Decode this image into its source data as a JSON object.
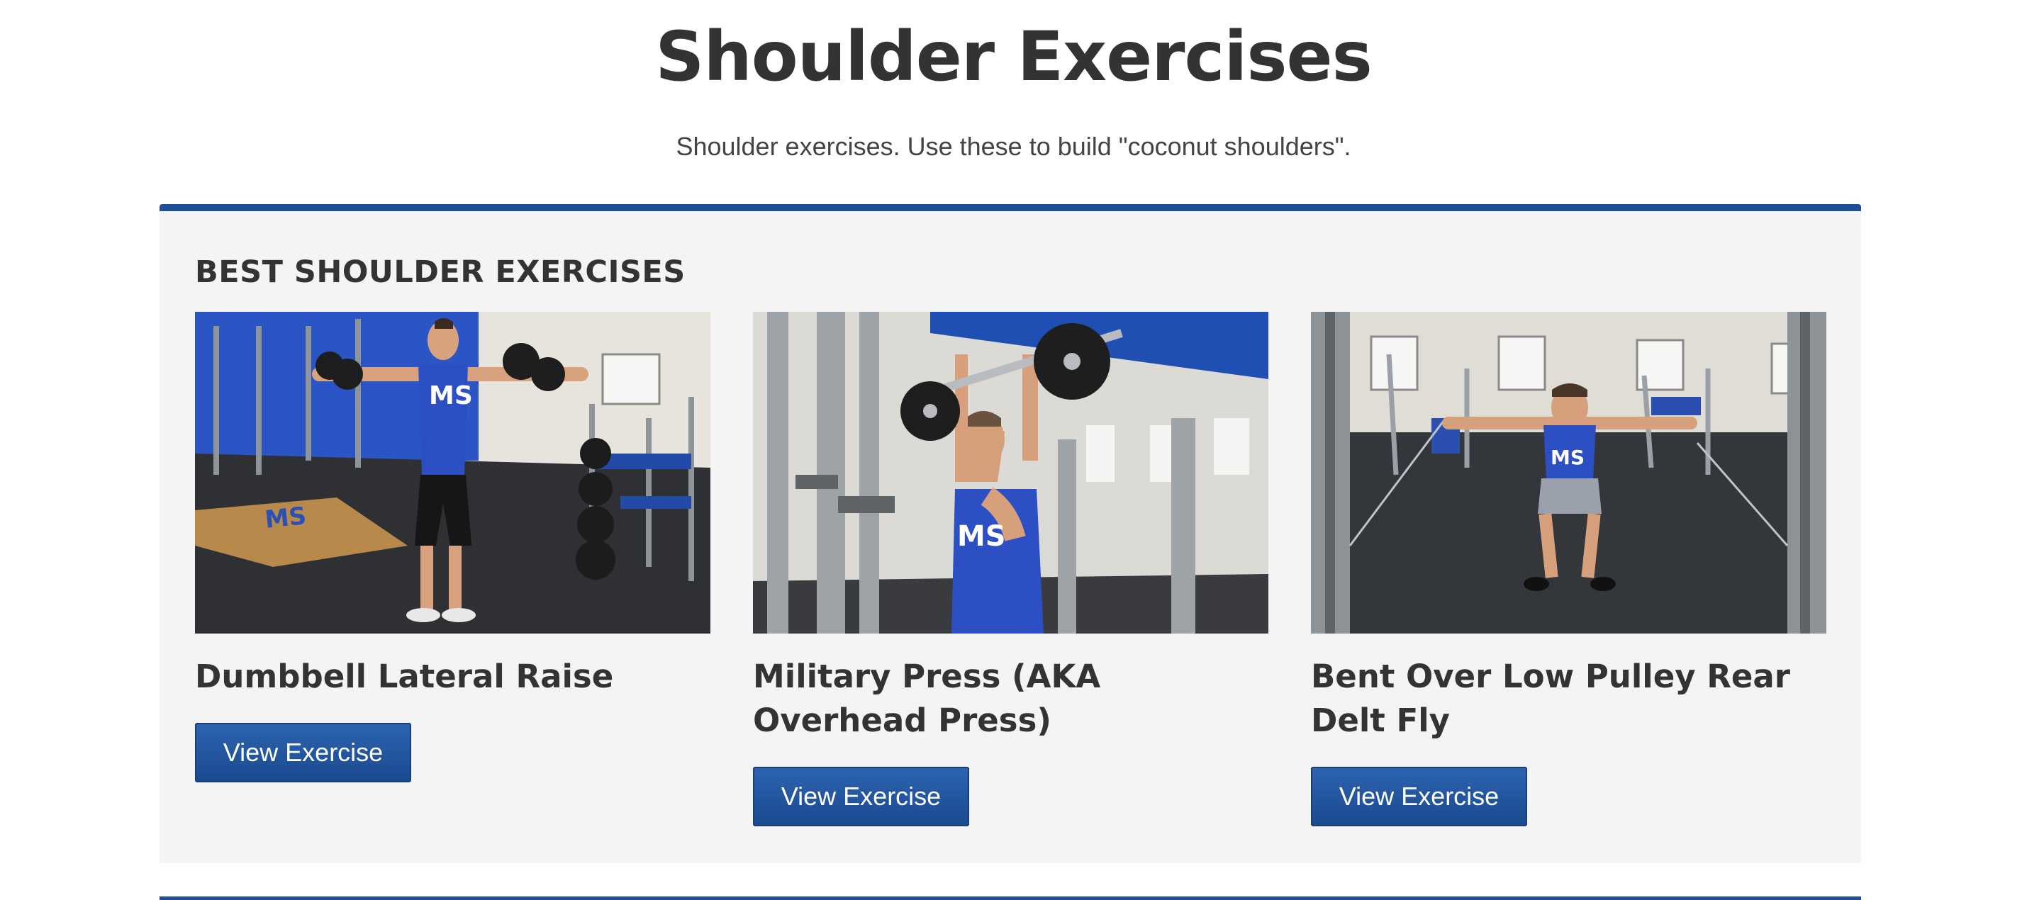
{
  "page": {
    "title": "Shoulder Exercises",
    "subtitle": "Shoulder exercises. Use these to build \"coconut shoulders\"."
  },
  "section": {
    "title": "BEST SHOULDER EXERCISES",
    "accent_color": "#1f4f96",
    "background_color": "#f4f4f4"
  },
  "exercises": [
    {
      "name": "Dumbbell Lateral Raise",
      "button_label": "View Exercise",
      "image_alt": "Man performing dumbbell lateral raise in gym"
    },
    {
      "name": "Military Press (AKA Overhead Press)",
      "button_label": "View Exercise",
      "image_alt": "Man pressing barbell overhead in squat rack"
    },
    {
      "name": "Bent Over Low Pulley Rear Delt Fly",
      "button_label": "View Exercise",
      "image_alt": "Man bent over performing cable rear delt fly"
    }
  ],
  "colors": {
    "button": "#1f4f96",
    "button_text": "#ffffff",
    "heading_text": "#333333",
    "shirt_blue": "#2d4fc4"
  }
}
